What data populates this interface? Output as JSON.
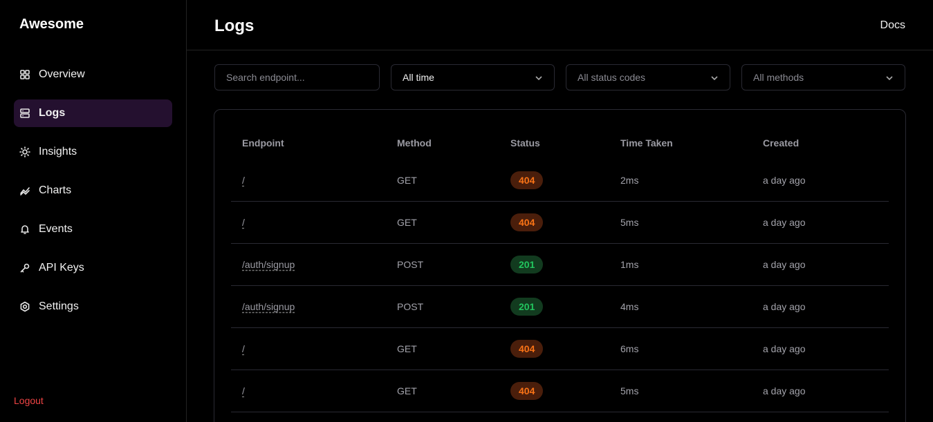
{
  "brand": "Awesome",
  "nav": [
    {
      "label": "Overview",
      "icon": "grid-icon"
    },
    {
      "label": "Logs",
      "icon": "logs-icon",
      "active": true
    },
    {
      "label": "Insights",
      "icon": "lightbulb-icon"
    },
    {
      "label": "Charts",
      "icon": "chart-line-icon"
    },
    {
      "label": "Events",
      "icon": "bell-icon"
    },
    {
      "label": "API Keys",
      "icon": "key-icon"
    },
    {
      "label": "Settings",
      "icon": "settings-icon"
    }
  ],
  "logout_label": "Logout",
  "header": {
    "title": "Logs",
    "docs_label": "Docs"
  },
  "filters": {
    "search_placeholder": "Search endpoint...",
    "time": "All time",
    "status": "All status codes",
    "method": "All methods"
  },
  "table": {
    "columns": [
      "Endpoint",
      "Method",
      "Status",
      "Time Taken",
      "Created"
    ],
    "rows": [
      {
        "endpoint": "/",
        "method": "GET",
        "status": "404",
        "time": "2ms",
        "created": "a day ago"
      },
      {
        "endpoint": "/",
        "method": "GET",
        "status": "404",
        "time": "5ms",
        "created": "a day ago"
      },
      {
        "endpoint": "/auth/signup",
        "method": "POST",
        "status": "201",
        "time": "1ms",
        "created": "a day ago"
      },
      {
        "endpoint": "/auth/signup",
        "method": "POST",
        "status": "201",
        "time": "4ms",
        "created": "a day ago"
      },
      {
        "endpoint": "/",
        "method": "GET",
        "status": "404",
        "time": "6ms",
        "created": "a day ago"
      },
      {
        "endpoint": "/",
        "method": "GET",
        "status": "404",
        "time": "5ms",
        "created": "a day ago"
      }
    ]
  },
  "colors": {
    "accent_active": "#24102f",
    "error": "#ef4444",
    "status_404": "#f97316",
    "status_201": "#22c55e"
  }
}
